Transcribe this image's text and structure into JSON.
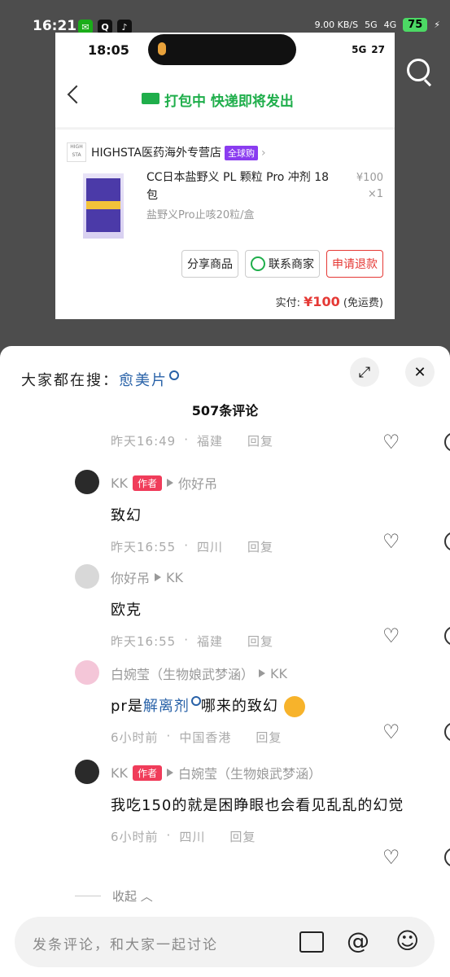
{
  "status_bar": {
    "time": "16:21",
    "net_speed": "9.00 KB/S",
    "signal": "5G",
    "signal2": "4G",
    "battery": "75"
  },
  "embedded_screenshot": {
    "time": "18:05",
    "network": "5G",
    "battery": "27",
    "title": "打包中 快递即将发出",
    "shop_name": "HIGHSTA医药海外专营店",
    "shop_tag": "全球购",
    "product_title": "CC日本盐野义 PL 颗粒 Pro 冲剂 18 包",
    "product_price": "¥100",
    "product_qty": "×1",
    "product_sku": "盐野义Pro止咳20粒/盒",
    "buttons": [
      "分享商品",
      "联系商家",
      "申请退款"
    ],
    "paid_label": "实付:",
    "paid_amount": "¥100",
    "paid_note": "(免运费)"
  },
  "sheet": {
    "hot_prefix": "大家都在搜：",
    "hot_term": "愈美片",
    "comment_count": "507条评论",
    "comments": [
      {
        "meta_time": "昨天16:49",
        "meta_loc": "福建",
        "reply": "回复"
      },
      {
        "user": "KK",
        "author_tag": "作者",
        "reply_to": "你好吊",
        "text": "致幻",
        "meta_time": "昨天16:55",
        "meta_loc": "四川",
        "reply": "回复"
      },
      {
        "user": "你好吊",
        "reply_to": "KK",
        "text": "欧克",
        "meta_time": "昨天16:55",
        "meta_loc": "福建",
        "reply": "回复"
      },
      {
        "user": "白婉莹（生物娘武梦涵）",
        "reply_to": "KK",
        "text_a": "pr是",
        "text_link": "解离剂",
        "text_b": "哪来的致幻",
        "meta_time": "6小时前",
        "meta_loc": "中国香港",
        "reply": "回复"
      },
      {
        "user": "KK",
        "author_tag": "作者",
        "reply_to": "白婉莹（生物娘武梦涵）",
        "text": "我吃150的就是困睁眼也会看见乱乱的幻觉",
        "meta_time": "6小时前",
        "meta_loc": "四川",
        "reply": "回复"
      }
    ],
    "collapse": "收起",
    "composer_placeholder": "发条评论，和大家一起讨论"
  }
}
